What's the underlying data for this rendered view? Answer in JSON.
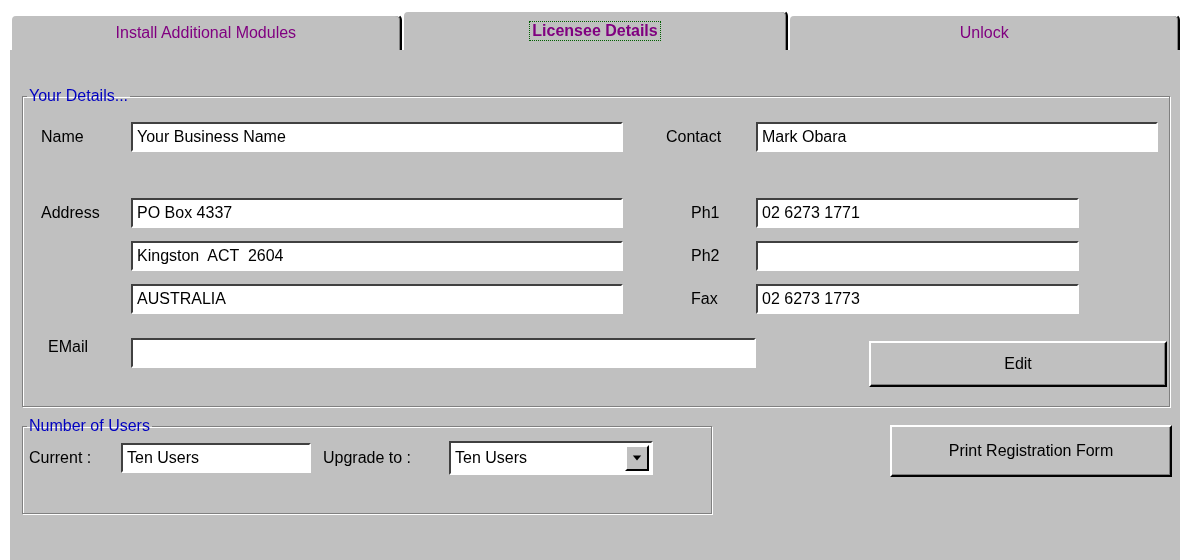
{
  "tabs": [
    {
      "label": "Install Additional Modules",
      "selected": false
    },
    {
      "label": "Licensee Details",
      "selected": true
    },
    {
      "label": "Unlock",
      "selected": false
    }
  ],
  "your_details": {
    "title": "Your Details...",
    "name": {
      "label": "Name",
      "value": "Your Business Name"
    },
    "contact": {
      "label": "Contact",
      "value": "Mark Obara"
    },
    "address": {
      "label": "Address",
      "lines": [
        "PO Box 4337",
        "Kingston  ACT  2604",
        "AUSTRALIA"
      ]
    },
    "phones": [
      {
        "label": "Ph1",
        "value": "02 6273 1771"
      },
      {
        "label": "Ph2"
      },
      {
        "label": "Fax",
        "value": "02 6273 1773"
      }
    ],
    "email": {
      "label": "EMail"
    },
    "edit_button": "Edit"
  },
  "number_of_users": {
    "title": "Number of Users",
    "current": {
      "label": "Current :",
      "value": "Ten Users"
    },
    "upgrade": {
      "label": "Upgrade to :",
      "value": "Ten Users"
    }
  },
  "print_button": "Print Registration Form"
}
